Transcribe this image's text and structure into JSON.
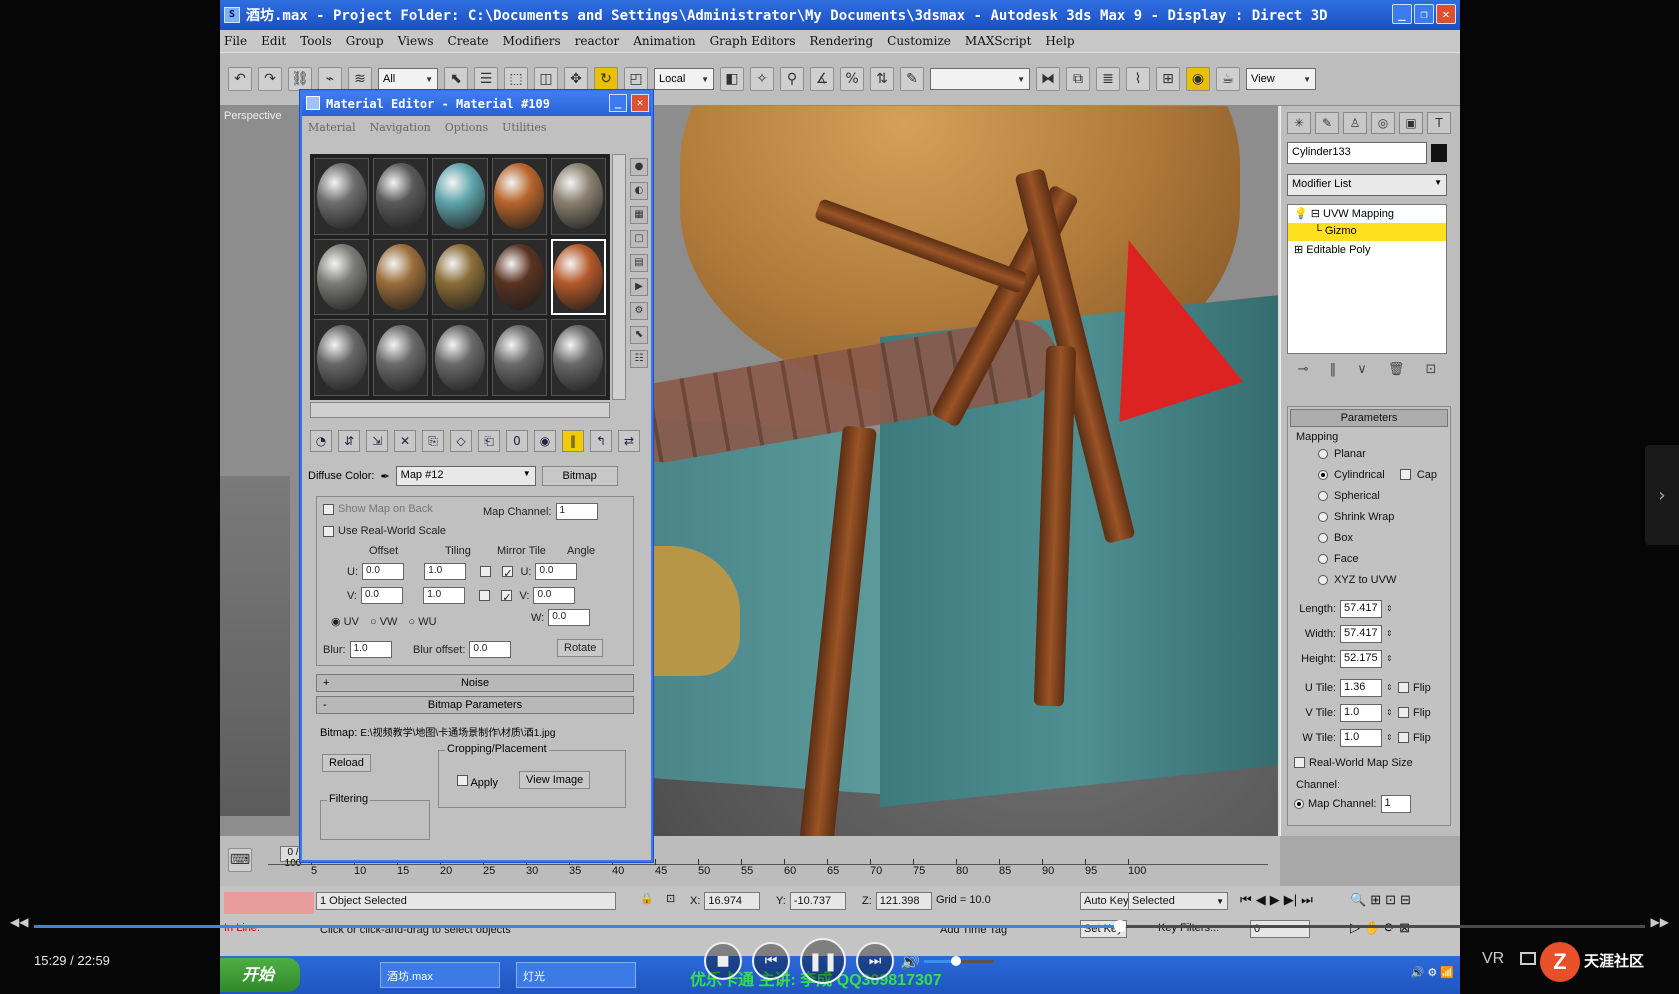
{
  "app": {
    "title": "酒坊.max   - Project Folder: C:\\Documents and Settings\\Administrator\\My Documents\\3dsmax   - Autodesk 3ds Max 9   - Display : Direct 3D",
    "menu": [
      "File",
      "Edit",
      "Tools",
      "Group",
      "Views",
      "Create",
      "Modifiers",
      "reactor",
      "Animation",
      "Graph Editors",
      "Rendering",
      "Customize",
      "MAXScript",
      "Help"
    ],
    "toolbar": {
      "selection_filter": "All",
      "ref_coord": "Local",
      "named_sel": "",
      "view_drop": "View"
    },
    "viewport_label": "Perspective"
  },
  "command_panel": {
    "object_name": "Cylinder133",
    "modifier_list": "Modifier List",
    "stack": [
      {
        "label": "UVW Mapping"
      },
      {
        "label": "Gizmo"
      },
      {
        "label": "Editable Poly"
      }
    ],
    "parameters": {
      "rollout": "Parameters",
      "group": "Mapping",
      "options": [
        "Planar",
        "Cylindrical",
        "Spherical",
        "Shrink Wrap",
        "Box",
        "Face",
        "XYZ to UVW"
      ],
      "selected": "Cylindrical",
      "cap_label": "Cap",
      "length_label": "Length:",
      "length": "57.417",
      "width_label": "Width:",
      "width": "57.417",
      "height_label": "Height:",
      "height": "52.175",
      "utile_label": "U Tile:",
      "utile": "1.36",
      "vtile_label": "V Tile:",
      "vtile": "1.0",
      "wtile_label": "W Tile:",
      "wtile": "1.0",
      "flip_label": "Flip",
      "real_world": "Real-World Map Size",
      "channel_group": "Channel:",
      "map_channel_label": "Map Channel:",
      "map_channel": "1"
    }
  },
  "material_editor": {
    "title": "Material Editor - Material #109",
    "menu": [
      "Material",
      "Navigation",
      "Options",
      "Utilities"
    ],
    "slots": [
      {
        "color": "#6e6e6e"
      },
      {
        "color": "#5a5a5a"
      },
      {
        "color": "#5fa6ad"
      },
      {
        "color": "#b8662c"
      },
      {
        "color": "#8a8070"
      },
      {
        "color": "#7c7c78"
      },
      {
        "color": "#9a6e3a"
      },
      {
        "color": "#8a6d38"
      },
      {
        "color": "#5a3322"
      },
      {
        "color": "#b5592a"
      },
      {
        "color": "#676767"
      },
      {
        "color": "#6a6a6a"
      },
      {
        "color": "#696969"
      },
      {
        "color": "#6a6a6a"
      },
      {
        "color": "#686868"
      }
    ],
    "diffuse_label": "Diffuse Color:",
    "map_name": "Map #12",
    "map_type": "Bitmap",
    "show_map_on_back": "Show Map on Back",
    "map_channel_label": "Map Channel:",
    "map_channel": "1",
    "use_real_world": "Use Real-World Scale",
    "col_offset": "Offset",
    "col_tiling": "Tiling",
    "col_mirror_tile": "Mirror Tile",
    "col_angle": "Angle",
    "u_offset": "0.0",
    "v_offset": "0.0",
    "u_tiling": "1.0",
    "v_tiling": "1.0",
    "u_angle": "0.0",
    "v_angle": "0.0",
    "w_angle": "0.0",
    "uv": "UV",
    "vw": "VW",
    "wu": "WU",
    "blur_label": "Blur:",
    "blur": "1.0",
    "blur_offset_label": "Blur offset:",
    "blur_offset": "0.0",
    "rotate": "Rotate",
    "noise": "Noise",
    "bitmap_params": "Bitmap Parameters",
    "bitmap_label": "Bitmap:",
    "bitmap_path": "E:\\视频教学\\地图\\卡通场景制作\\材质\\酒1.jpg",
    "reload": "Reload",
    "cropping": "Cropping/Placement",
    "apply": "Apply",
    "view_image": "View Image",
    "filtering": "Filtering"
  },
  "timeline": {
    "slider": "0 / 100",
    "ticks": [
      "5",
      "10",
      "15",
      "20",
      "25",
      "30",
      "35",
      "40",
      "45",
      "50",
      "55",
      "60",
      "65",
      "70",
      "75",
      "80",
      "85",
      "90",
      "95",
      "100"
    ]
  },
  "status": {
    "selected": "1 Object Selected",
    "hint": "Click or click-and-drag to select objects",
    "in_line": "In Line:",
    "x": "16.974",
    "y": "-10.737",
    "z": "121.398",
    "grid": "Grid = 10.0",
    "auto_key": "Auto Key",
    "set_key": "Set Key",
    "key_mode": "Selected",
    "key_filters": "Key Filters...",
    "add_time_tag": "Add Time Tag",
    "frame": "0"
  },
  "taskbar": {
    "start": "开始",
    "tasks": [
      "酒坊.max",
      "灯光"
    ],
    "marquee": "优乐卡通 主讲: 李成 QQ309817307"
  },
  "player": {
    "time": "15:29 / 22:59",
    "progress": 0.674,
    "volume": 0.45,
    "vr": "VR",
    "watermark": "天涯社区"
  }
}
